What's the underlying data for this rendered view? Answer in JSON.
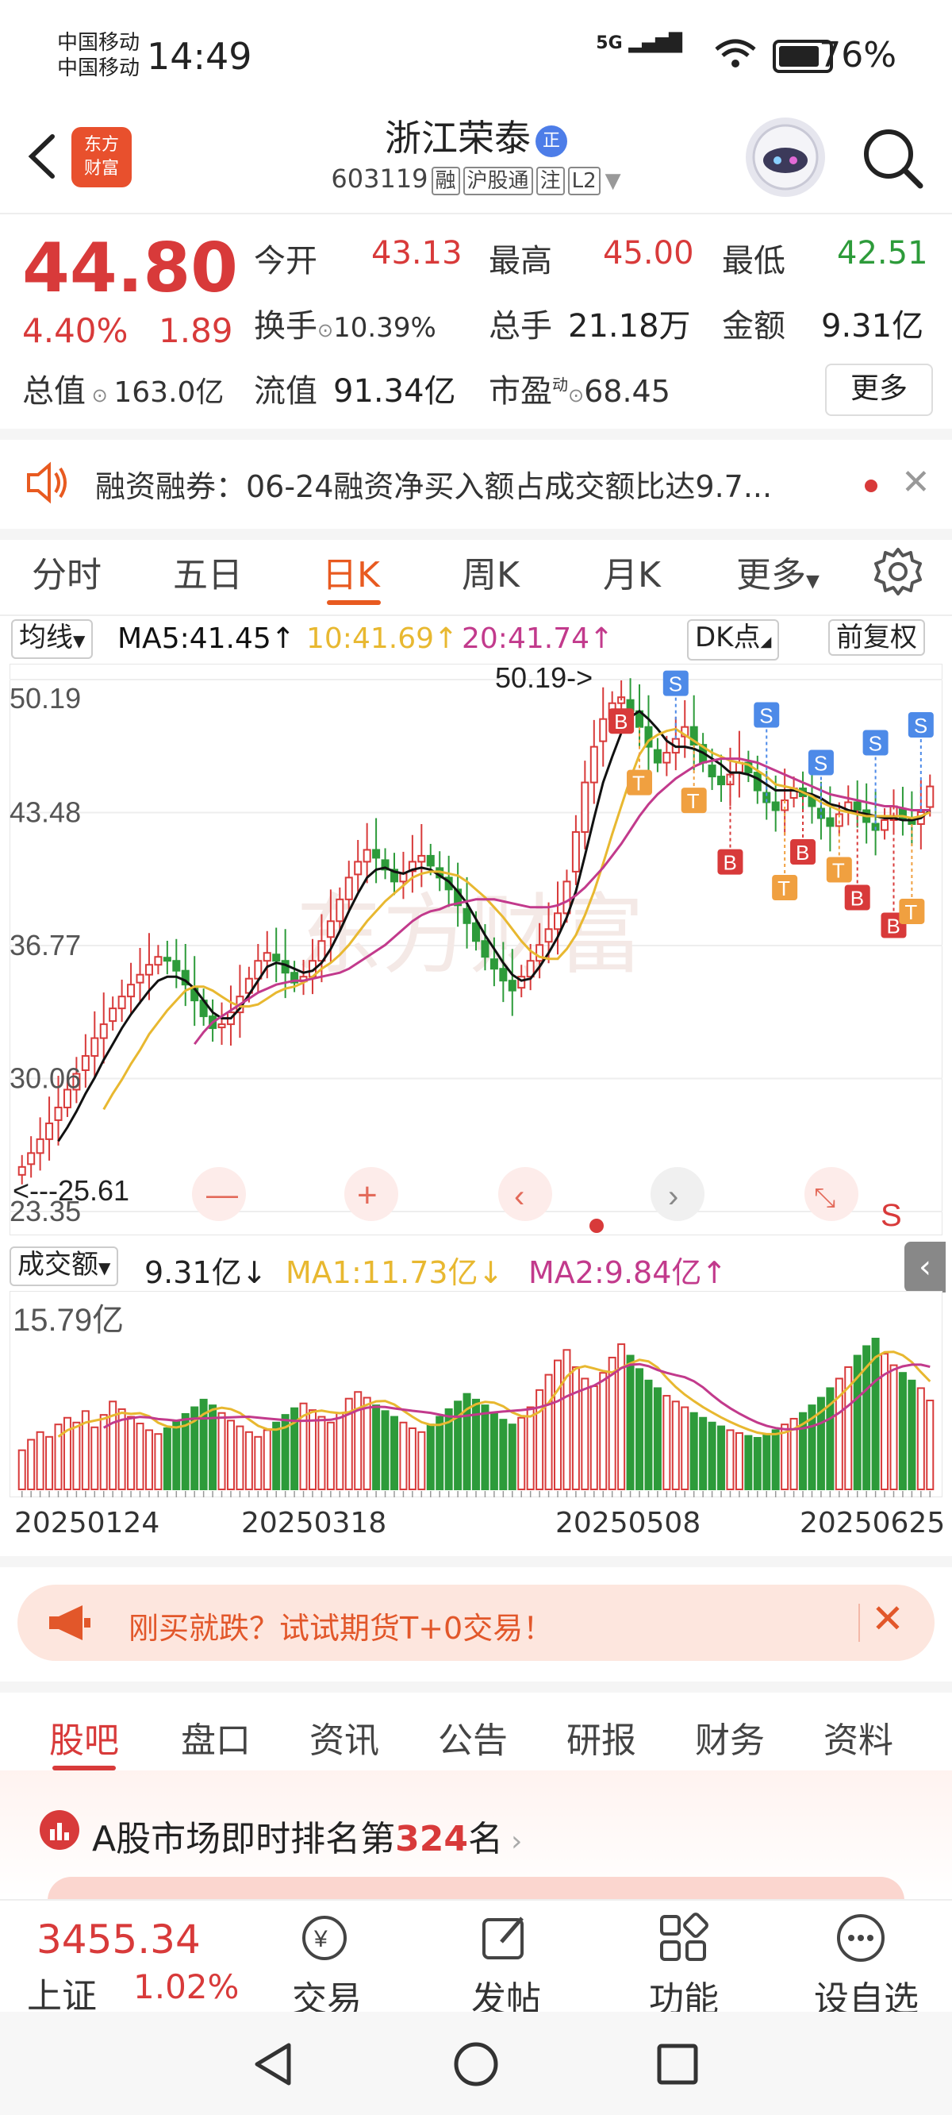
{
  "status_bar": {
    "carrier1": "中国移动",
    "carrier2": "中国移动",
    "time": "14:49",
    "battery": "76%",
    "signal": "5G"
  },
  "header": {
    "logo_text": "东方\n财富",
    "name": "浙江荣泰",
    "cert_badge": "正",
    "code": "603119",
    "tags": [
      "融",
      "沪股通",
      "注",
      "L2"
    ]
  },
  "quote": {
    "price": "44.80",
    "pct": "4.40%",
    "chg": "1.89",
    "open_label": "今开",
    "open": "43.13",
    "high_label": "最高",
    "high": "45.00",
    "low_label": "最低",
    "low": "42.51",
    "turnover_label": "换手",
    "turnover": "10.39%",
    "volume_label": "总手",
    "volume": "21.18万",
    "amount_label": "金额",
    "amount": "9.31亿",
    "mktcap_label": "总值",
    "mktcap": "163.0亿",
    "float_label": "流值",
    "float": "91.34亿",
    "pe_label": "市盈",
    "pe_sup": "动",
    "pe": "68.45",
    "more": "更多"
  },
  "notice": {
    "text": "融资融券：06-24融资净买入额占成交额比达9.7..."
  },
  "period_tabs": [
    "分时",
    "五日",
    "日K",
    "周K",
    "月K",
    "更多"
  ],
  "ma_row": {
    "selector": "均线",
    "ma5": "MA5:41.45",
    "ma10": "10:41.69",
    "ma20": "20:41.74",
    "dk": "DK点",
    "adjust": "前复权"
  },
  "price_axis": [
    "50.19",
    "43.48",
    "36.77",
    "30.06",
    "23.35"
  ],
  "annotations": {
    "high_marker": "50.19->",
    "low_marker": "<---25.61"
  },
  "vol_row": {
    "selector": "成交额",
    "value": "9.31亿",
    "ma1": "MA1:11.73亿",
    "ma2": "MA2:9.84亿",
    "axis_max": "15.79亿"
  },
  "dates": [
    "20250124",
    "20250318",
    "20250508",
    "20250625"
  ],
  "promo": {
    "text": "刚买就跌？试试期货T+0交易！"
  },
  "news_tabs": [
    "股吧",
    "盘口",
    "资讯",
    "公告",
    "研报",
    "财务",
    "资料"
  ],
  "rank": {
    "prefix": "A股市场即时排名第",
    "number": "324",
    "suffix": "名"
  },
  "bottom_nav": {
    "index_value": "3455.34",
    "index_name": "上证",
    "index_pct": "1.02%",
    "items": [
      "交易",
      "发帖",
      "功能",
      "设自选"
    ]
  },
  "colors": {
    "up": "#d83a3a",
    "down": "#2d9b3a",
    "accent": "#e85a20",
    "ma5": "#111111",
    "ma10": "#e8b830",
    "ma20": "#c23a8c"
  },
  "chart_data": {
    "type": "candlestick",
    "title": "",
    "ylim": [
      23.35,
      50.19
    ],
    "x_labels": [
      "20250124",
      "20250318",
      "20250508",
      "20250625"
    ],
    "high_marker": 50.19,
    "low_marker": 25.61,
    "closes": [
      25.6,
      26.3,
      27.0,
      27.8,
      28.6,
      29.5,
      30.3,
      31.2,
      32.1,
      32.8,
      33.6,
      34.2,
      34.8,
      35.3,
      35.8,
      36.2,
      36.0,
      35.5,
      34.8,
      34.0,
      33.2,
      32.6,
      32.8,
      33.4,
      34.2,
      35.1,
      36.0,
      36.4,
      36.0,
      35.4,
      34.9,
      35.2,
      36.0,
      37.0,
      38.0,
      39.1,
      40.2,
      41.0,
      41.6,
      41.2,
      40.6,
      40.0,
      40.4,
      41.0,
      41.3,
      40.8,
      40.2,
      39.6,
      38.8,
      37.9,
      37.0,
      36.2,
      35.6,
      35.0,
      34.5,
      35.2,
      36.0,
      36.8,
      37.6,
      38.4,
      40.0,
      42.5,
      45.0,
      46.8,
      48.2,
      49.0,
      49.3,
      48.6,
      47.8,
      46.8,
      46.0,
      46.5,
      47.2,
      47.8,
      46.9,
      46.0,
      45.3,
      44.9,
      45.4,
      46.0,
      45.5,
      44.6,
      44.0,
      43.6,
      44.1,
      44.7,
      44.3,
      43.8,
      43.2,
      42.8,
      43.4,
      44.0,
      43.6,
      43.0,
      42.6,
      43.1,
      43.8,
      43.2,
      42.9,
      43.5,
      44.8
    ],
    "ma5": [
      null,
      null,
      null,
      null,
      26.9,
      27.6,
      28.4,
      29.3,
      30.1,
      31.0,
      31.8,
      32.6,
      33.3,
      33.9,
      34.5,
      35.0,
      35.2,
      35.2,
      35.0,
      34.6,
      34.0,
      33.4,
      33.1,
      33.1,
      33.6,
      34.3,
      35.0,
      35.7,
      35.9,
      35.8,
      35.6,
      35.4,
      35.5,
      35.9,
      36.6,
      37.5,
      38.5,
      39.4,
      40.2,
      40.6,
      40.7,
      40.5,
      40.4,
      40.6,
      40.7,
      40.6,
      40.3,
      40.0,
      39.5,
      38.9,
      38.1,
      37.3,
      36.6,
      35.9,
      35.3,
      35.0,
      35.1,
      35.7,
      36.4,
      37.2,
      38.2,
      39.5,
      41.3,
      43.2,
      45.0,
      46.3,
      47.5,
      48.3,
      48.6,
      48.2,
      47.7,
      47.1,
      46.8,
      46.8,
      46.7,
      46.5,
      46.2,
      45.9,
      45.5,
      45.5,
      45.4,
      45.2,
      44.9,
      44.6,
      44.6,
      44.6,
      44.5,
      44.4,
      44.2,
      43.9,
      43.8,
      43.6,
      43.5,
      43.4,
      43.3,
      43.2,
      43.2,
      43.1,
      43.1,
      43.2,
      43.6
    ],
    "ma10": [
      null,
      null,
      null,
      null,
      null,
      null,
      null,
      null,
      null,
      28.5,
      29.3,
      30.0,
      30.8,
      31.5,
      32.3,
      32.9,
      33.5,
      34.0,
      34.5,
      34.7,
      34.7,
      34.5,
      34.2,
      33.9,
      33.7,
      33.7,
      33.8,
      34.1,
      34.4,
      34.6,
      34.7,
      34.9,
      35.2,
      35.6,
      35.9,
      36.3,
      36.8,
      37.4,
      38.0,
      38.5,
      39.0,
      39.4,
      39.8,
      40.2,
      40.4,
      40.5,
      40.5,
      40.4,
      40.3,
      40.0,
      39.6,
      39.2,
      38.7,
      38.2,
      37.6,
      37.0,
      36.5,
      36.2,
      36.1,
      36.1,
      36.6,
      37.3,
      38.3,
      39.5,
      40.9,
      42.4,
      43.8,
      45.2,
      46.4,
      47.1,
      47.4,
      47.6,
      47.7,
      47.4,
      47.1,
      46.8,
      46.5,
      46.3,
      46.1,
      46.0,
      45.9,
      45.6,
      45.3,
      44.9,
      44.8,
      44.7,
      44.5,
      44.3,
      44.0,
      43.8,
      43.6,
      43.5,
      43.4,
      43.3,
      43.3,
      43.3,
      43.3,
      43.3,
      43.2,
      43.3,
      43.5
    ],
    "ma20": [
      null,
      null,
      null,
      null,
      null,
      null,
      null,
      null,
      null,
      null,
      null,
      null,
      null,
      null,
      null,
      null,
      null,
      null,
      null,
      31.8,
      32.4,
      32.9,
      33.2,
      33.5,
      33.8,
      34.1,
      34.4,
      34.6,
      34.8,
      34.9,
      35.0,
      35.0,
      35.1,
      35.2,
      35.3,
      35.4,
      35.6,
      35.9,
      36.2,
      36.5,
      36.8,
      37.2,
      37.6,
      38.0,
      38.3,
      38.5,
      38.6,
      38.8,
      38.9,
      39.0,
      39.1,
      39.1,
      39.1,
      39.0,
      38.9,
      38.8,
      38.7,
      38.7,
      38.7,
      38.8,
      39.0,
      39.3,
      39.7,
      40.2,
      40.7,
      41.3,
      41.9,
      42.6,
      43.3,
      43.9,
      44.4,
      44.8,
      45.2,
      45.5,
      45.8,
      46.0,
      46.1,
      46.2,
      46.2,
      46.2,
      46.1,
      46.0,
      45.8,
      45.6,
      45.4,
      45.2,
      45.0,
      44.8,
      44.6,
      44.4,
      44.3,
      44.2,
      44.1,
      44.0,
      43.9,
      43.8,
      43.8,
      43.7,
      43.6,
      43.6,
      43.6
    ],
    "volume": [
      4.1,
      5.2,
      6.0,
      5.5,
      6.8,
      7.5,
      7.0,
      8.2,
      6.5,
      7.8,
      9.2,
      8.4,
      7.6,
      6.9,
      6.2,
      5.8,
      6.4,
      7.1,
      7.9,
      8.6,
      9.4,
      8.8,
      8.0,
      7.2,
      6.6,
      6.0,
      5.5,
      6.2,
      7.0,
      7.8,
      8.5,
      9.0,
      8.3,
      7.6,
      7.0,
      8.0,
      9.5,
      10.2,
      9.6,
      8.8,
      8.2,
      7.6,
      7.0,
      6.4,
      6.0,
      6.8,
      7.6,
      8.4,
      9.2,
      10.0,
      9.4,
      8.8,
      8.0,
      7.3,
      6.8,
      7.5,
      8.6,
      10.4,
      12.0,
      13.5,
      14.6,
      12.8,
      11.6,
      10.8,
      12.2,
      13.8,
      15.2,
      14.0,
      12.6,
      11.4,
      10.6,
      9.8,
      9.2,
      8.6,
      8.0,
      7.5,
      7.0,
      6.6,
      6.2,
      5.9,
      5.6,
      5.4,
      5.8,
      6.2,
      6.8,
      7.4,
      8.0,
      8.8,
      9.6,
      10.6,
      11.6,
      12.8,
      14.0,
      15.0,
      15.79,
      14.2,
      13.0,
      12.2,
      11.4,
      10.6,
      9.31
    ]
  }
}
